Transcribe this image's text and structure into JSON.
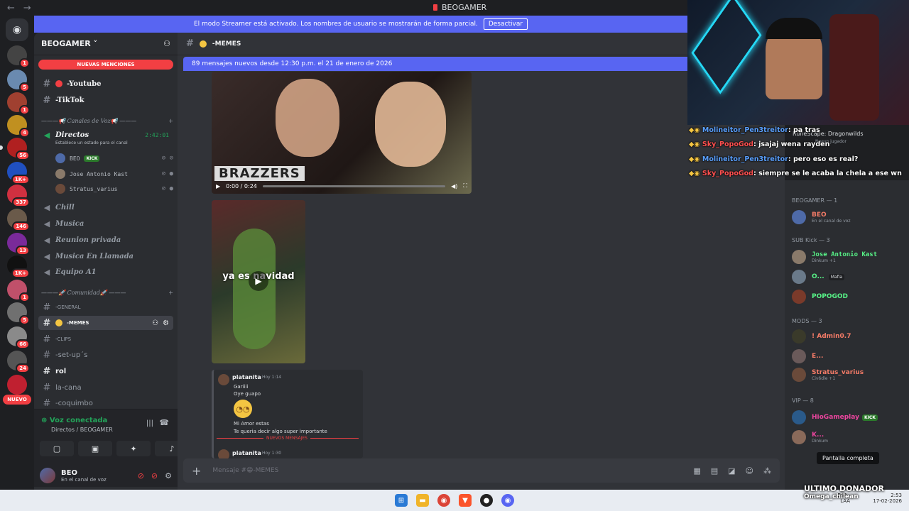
{
  "titlebar": {
    "title": "BEOGAMER",
    "back": "←",
    "forward": "→"
  },
  "banner": {
    "text": "El modo Streamer está activado. Los nombres de usuario se mostrarán de forma parcial.",
    "button": "Desactivar"
  },
  "rail": {
    "badges": [
      "1",
      "5",
      "1",
      "4",
      "56",
      "1K+",
      "337",
      "146",
      "13",
      "1K+",
      "1",
      "5",
      "66",
      "24"
    ],
    "nuevo": "NUEVO"
  },
  "server": {
    "name": "BEOGAMER",
    "mentions": "NUEVAS MENCIONES"
  },
  "channels": {
    "youtube": "-Youtube",
    "tiktok": "-TikTok",
    "cat_voice": "———📢 Canales de Voz📢 ———",
    "directos": "Directos",
    "directos_time": "2:42:01",
    "directos_status": "Establece un estado para el canal",
    "voice_users": [
      {
        "name": "BEO",
        "tag": "KICK"
      },
      {
        "name": "Jose Antonio Kast",
        "tag": ""
      },
      {
        "name": "Stratus_varius",
        "tag": ""
      }
    ],
    "chill": "Chill",
    "musica": "Musica",
    "reunion": "Reunion privada",
    "musica_llamada": "Musica En Llamada",
    "equipo": "Equipo A1",
    "cat_comunidad": "———🚀 Comunidad🚀 ———",
    "general": "-GENERAL",
    "memes": "-MEMES",
    "clips": "-CLIPS",
    "setups": "-set-up´s",
    "rol": "rol",
    "lacana": "la-cana",
    "coquimbo": "-coquimbo"
  },
  "voice_panel": {
    "status": "Voz conectada",
    "sub": "Directos / BEOGAMER"
  },
  "user": {
    "name": "BEO",
    "status": "En el canal de voz"
  },
  "chat": {
    "channel": "-MEMES",
    "new_messages": "89 mensajes nuevos desde 12:30 p.m. el 21 de enero de 2026",
    "video_brand": "BRAZZERS",
    "video_time": "0:00 / 0:24",
    "clip_caption": "ya es navidad",
    "forward": {
      "author": "platanita",
      "time": "Hoy 1:14",
      "lines": [
        "Gariiii",
        "Oye guapo",
        "Mi Amor estas",
        "Te queria decir algo super importante"
      ],
      "divider": "NUEVOS MENSAJES",
      "author2": "platanita",
      "time2": "Hoy 1:30"
    },
    "placeholder": "Mensaje #😁-MEMES"
  },
  "overlay": {
    "lines": [
      {
        "user": "Molineitor_Pen3treitor",
        "text": ": pa tras"
      },
      {
        "user": "Sky_PopoGod",
        "text": ": jsajaj wena rayden"
      },
      {
        "user": "Molineitor_Pen3treitor",
        "text": ": pero eso es real?"
      },
      {
        "user": "Sky_PopoGod",
        "text": ": siempre se le acaba la chela a ese wn"
      }
    ],
    "rs_title": "RuneScape: Dragonwilds",
    "rs_sub": "Nuevo jugador"
  },
  "members": {
    "groups": [
      {
        "title": "BEOGAMER — 1"
      },
      {
        "title": "SUB Kick — 3"
      },
      {
        "title": "MODS — 3"
      },
      {
        "title": "VIP — 8"
      }
    ],
    "list": [
      {
        "name": "BEO",
        "sub": "En el canal de voz",
        "color": "#f47b67"
      },
      {
        "name": "Jose Antonio Kast",
        "sub": "Dinkum +1",
        "color": "#57f287"
      },
      {
        "name": "O...",
        "sub": "Mafia",
        "color": "#57f287"
      },
      {
        "name": "POPOGOD",
        "sub": "",
        "color": "#57f287"
      },
      {
        "name": "! Admin0.7",
        "sub": "",
        "color": "#f47b67"
      },
      {
        "name": "E...",
        "sub": "",
        "color": "#f47b67"
      },
      {
        "name": "Stratus_varius",
        "sub": "Civ6dle +1",
        "color": "#f47b67"
      },
      {
        "name": "HioGameplay",
        "sub": "",
        "color": "#eb459e"
      },
      {
        "name": "K...",
        "sub": "Dinkum",
        "color": "#eb459e"
      }
    ],
    "tooltip": "Pantalla completa"
  },
  "taskbar": {
    "lang": "ESP",
    "lang2": "LAA",
    "time": "2:53",
    "date": "17-02-2026",
    "donor_title": "ULTIMO DONADOR",
    "donor_name": "Omega_chilean"
  }
}
